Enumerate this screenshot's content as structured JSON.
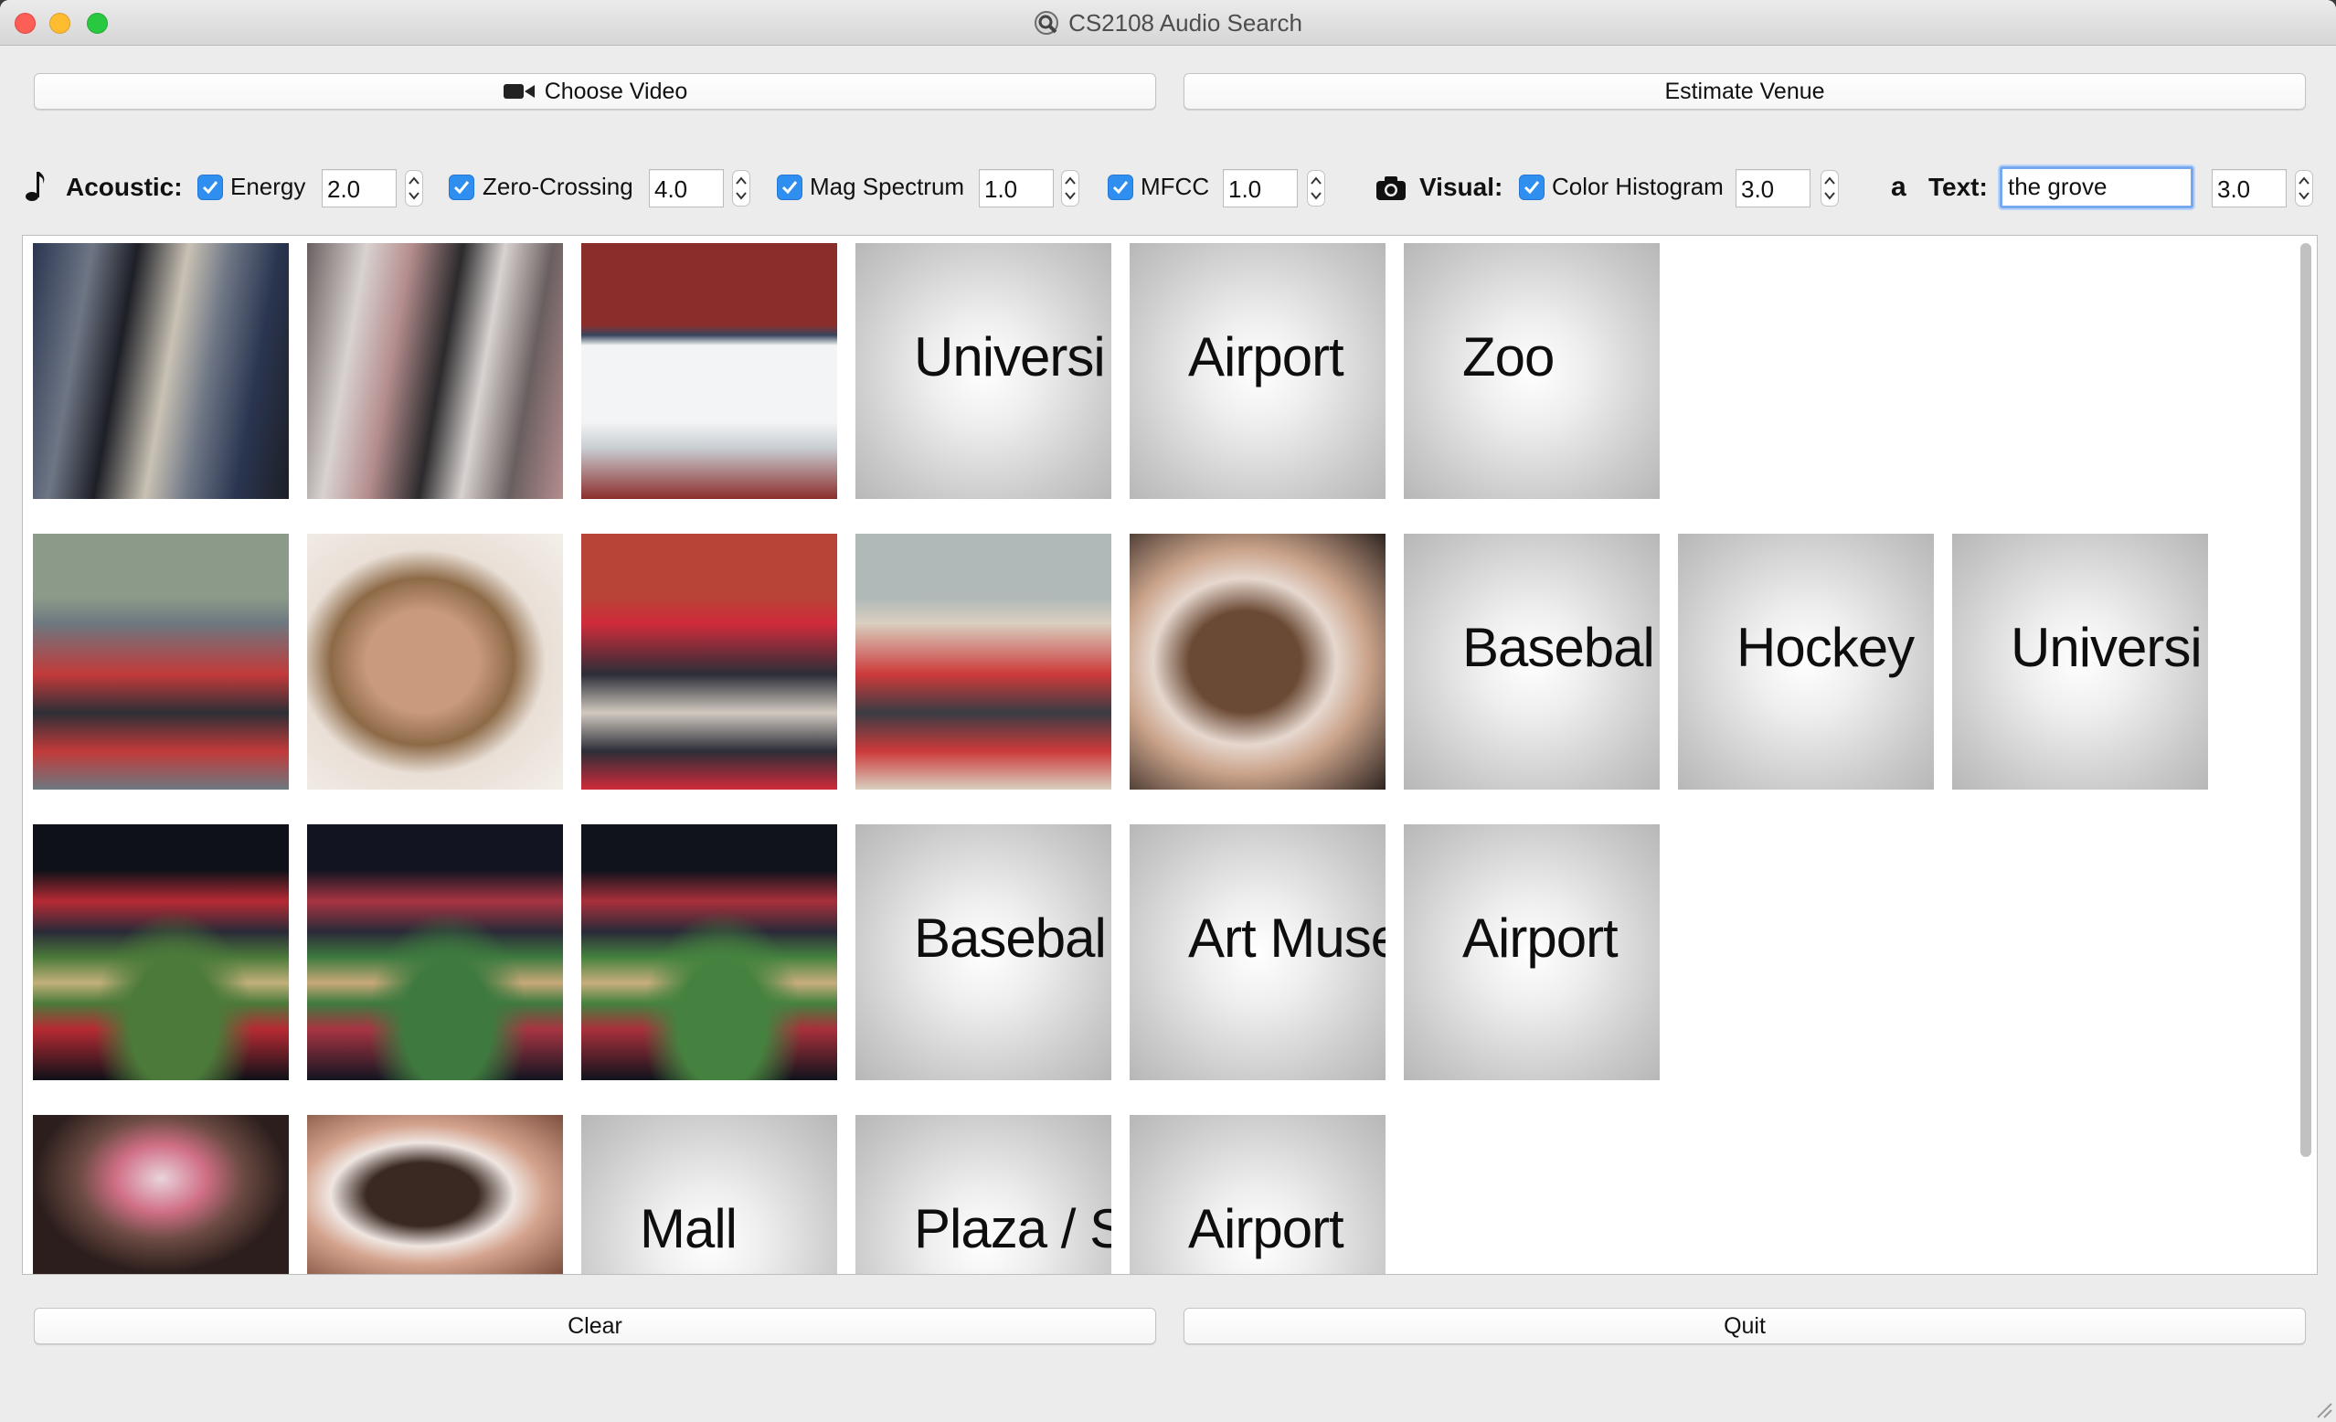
{
  "window": {
    "title": "CS2108 Audio Search"
  },
  "toolbar": {
    "choose_video_label": "Choose Video",
    "estimate_venue_label": "Estimate Venue"
  },
  "features": {
    "acoustic_label": "Acoustic:",
    "energy": {
      "label": "Energy",
      "checked": true,
      "weight": "2.0"
    },
    "zero_crossing": {
      "label": "Zero-Crossing",
      "checked": true,
      "weight": "4.0"
    },
    "mag_spectrum": {
      "label": "Mag Spectrum",
      "checked": true,
      "weight": "1.0"
    },
    "mfcc": {
      "label": "MFCC",
      "checked": true,
      "weight": "1.0"
    },
    "visual_label": "Visual:",
    "color_histogram": {
      "label": "Color Histogram",
      "checked": true,
      "weight": "3.0"
    },
    "text_label": "Text:",
    "text_glyph": "a",
    "text_query": "the grove",
    "text_weight": "3.0"
  },
  "results": {
    "rows": [
      {
        "images": [
          {
            "kind": "photo",
            "scene": "blurred-crowd",
            "palette": [
              "#2a3550",
              "#6e7685",
              "#c9c2b4",
              "#1d1f26"
            ]
          },
          {
            "kind": "photo",
            "scene": "blurred-jersey",
            "palette": [
              "#6a5f60",
              "#d8d2d0",
              "#2b2a2c",
              "#b58d8e"
            ]
          },
          {
            "kind": "photo",
            "scene": "hockey-rink",
            "palette": [
              "#8b2e2b",
              "#f2f4f5",
              "#c9ced3",
              "#38465e"
            ]
          }
        ],
        "labels": [
          "Universi",
          "Airport",
          "Zoo"
        ]
      },
      {
        "images": [
          {
            "kind": "photo",
            "scene": "tailgate-crowd",
            "palette": [
              "#8c9a8a",
              "#c23a3a",
              "#2d2f36",
              "#6d7880"
            ]
          },
          {
            "kind": "photo",
            "scene": "selfie-girl",
            "palette": [
              "#e9dfd6",
              "#c99a7e",
              "#8d6a47",
              "#f3efe9"
            ]
          },
          {
            "kind": "photo",
            "scene": "street-crowd",
            "palette": [
              "#b84337",
              "#2c2e38",
              "#d2c9c0",
              "#cf2b3a"
            ]
          },
          {
            "kind": "photo",
            "scene": "stands-fan",
            "palette": [
              "#b0b8b8",
              "#cc3a3a",
              "#3a3c44",
              "#d9cfc0"
            ]
          },
          {
            "kind": "photo",
            "scene": "selfie-close",
            "palette": [
              "#caa38a",
              "#6b4a35",
              "#e6d8cf",
              "#2e2420"
            ]
          }
        ],
        "labels": [
          "Basebal",
          "Hockey",
          "Universi"
        ]
      },
      {
        "images": [
          {
            "kind": "photo",
            "scene": "stadium-night",
            "palette": [
              "#0f1118",
              "#4b7a3a",
              "#c2b07a",
              "#b62a33"
            ]
          },
          {
            "kind": "photo",
            "scene": "stadium-night",
            "palette": [
              "#121521",
              "#3e7a3f",
              "#c7a878",
              "#a83442"
            ]
          },
          {
            "kind": "photo",
            "scene": "stadium-night",
            "palette": [
              "#10131c",
              "#45823f",
              "#c8ad7d",
              "#a8303b"
            ]
          }
        ],
        "labels": [
          "Basebal",
          "Art Muse",
          "Airport"
        ]
      },
      {
        "images": [
          {
            "kind": "photo",
            "scene": "store-front",
            "palette": [
              "#2b1e1c",
              "#d06f86",
              "#e9d4dc",
              "#6d4b44"
            ]
          },
          {
            "kind": "photo",
            "scene": "selfie-pout",
            "palette": [
              "#d4a38e",
              "#3a2822",
              "#efe6e1",
              "#7e4f3e"
            ]
          }
        ],
        "labels": [
          "Mall",
          "Plaza / S",
          "Airport"
        ]
      }
    ]
  },
  "bottom": {
    "clear_label": "Clear",
    "quit_label": "Quit"
  }
}
